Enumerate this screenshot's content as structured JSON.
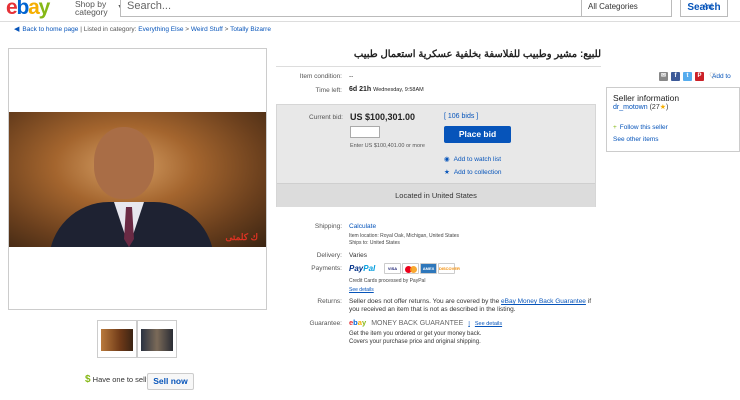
{
  "header": {
    "logo": [
      "e",
      "b",
      "a",
      "y"
    ],
    "shop_by_line1": "Shop by",
    "shop_by_line2": "category",
    "search_placeholder": "Search...",
    "category_select": "All Categories",
    "advanced": "Ad",
    "search_button": "Search"
  },
  "breadcrumb": {
    "back": "Back to home page",
    "listed_in": "| Listed in category:",
    "items": [
      "Everything Else",
      "Weird Stuff",
      "Totally Bizarre"
    ],
    "sep": ">"
  },
  "listing": {
    "title": "للبيع: مشير وطبيب للفلاسفة بخلفية عسكرية استعمال طبيب",
    "image_watermark": "ك كلمتى",
    "condition_label": "Item condition:",
    "condition_value": "--",
    "time_label": "Time left:",
    "time_value": "6d 21h",
    "time_detail": "Wednesday, 9:58AM",
    "bid": {
      "label": "Current bid:",
      "value": "US $100,301.00",
      "bids_link": "[ 106 bids ]",
      "enter_note": "Enter US $100,401.00 or more",
      "place_bid": "Place bid",
      "watch": "Add to watch list",
      "collection": "Add to collection",
      "located": "Located in United States"
    },
    "shipping": {
      "label": "Shipping:",
      "value": "Calculate",
      "location": "Item location: Royal Oak, Michigan, United States",
      "ships_to": "Ships to: United States"
    },
    "delivery": {
      "label": "Delivery:",
      "value": "Varies"
    },
    "payments": {
      "label": "Payments:",
      "paypal_1": "Pay",
      "paypal_2": "Pal",
      "cards": [
        "VISA",
        "",
        "AMEX",
        "DISCOVER"
      ],
      "note": "Credit Cards processed by PayPal",
      "see_details": "See details"
    },
    "returns": {
      "label": "Returns:",
      "text": "Seller does not offer returns. You are covered by the ",
      "link": "eBay Money Back Guarantee",
      "text2": " if you received an item that is not as described in the listing."
    },
    "guarantee": {
      "label": "Guarantee:",
      "badge": "MONEY BACK GUARANTEE",
      "separator": "|",
      "see_details": "See details",
      "note1": "Get the item you ordered or get your money back.",
      "note2": "Covers your purchase price and original shipping."
    }
  },
  "sell": {
    "dollar": "$",
    "text": "Have one to sell?",
    "button": "Sell now"
  },
  "share": {
    "icons": [
      "✉",
      "f",
      "t",
      "P"
    ],
    "add_to": "Add to"
  },
  "seller": {
    "title": "Seller information",
    "name": "dr_motown",
    "feedback": "(27",
    "feedback_close": ")",
    "follow": "Follow this seller",
    "other_items": "See other items"
  }
}
